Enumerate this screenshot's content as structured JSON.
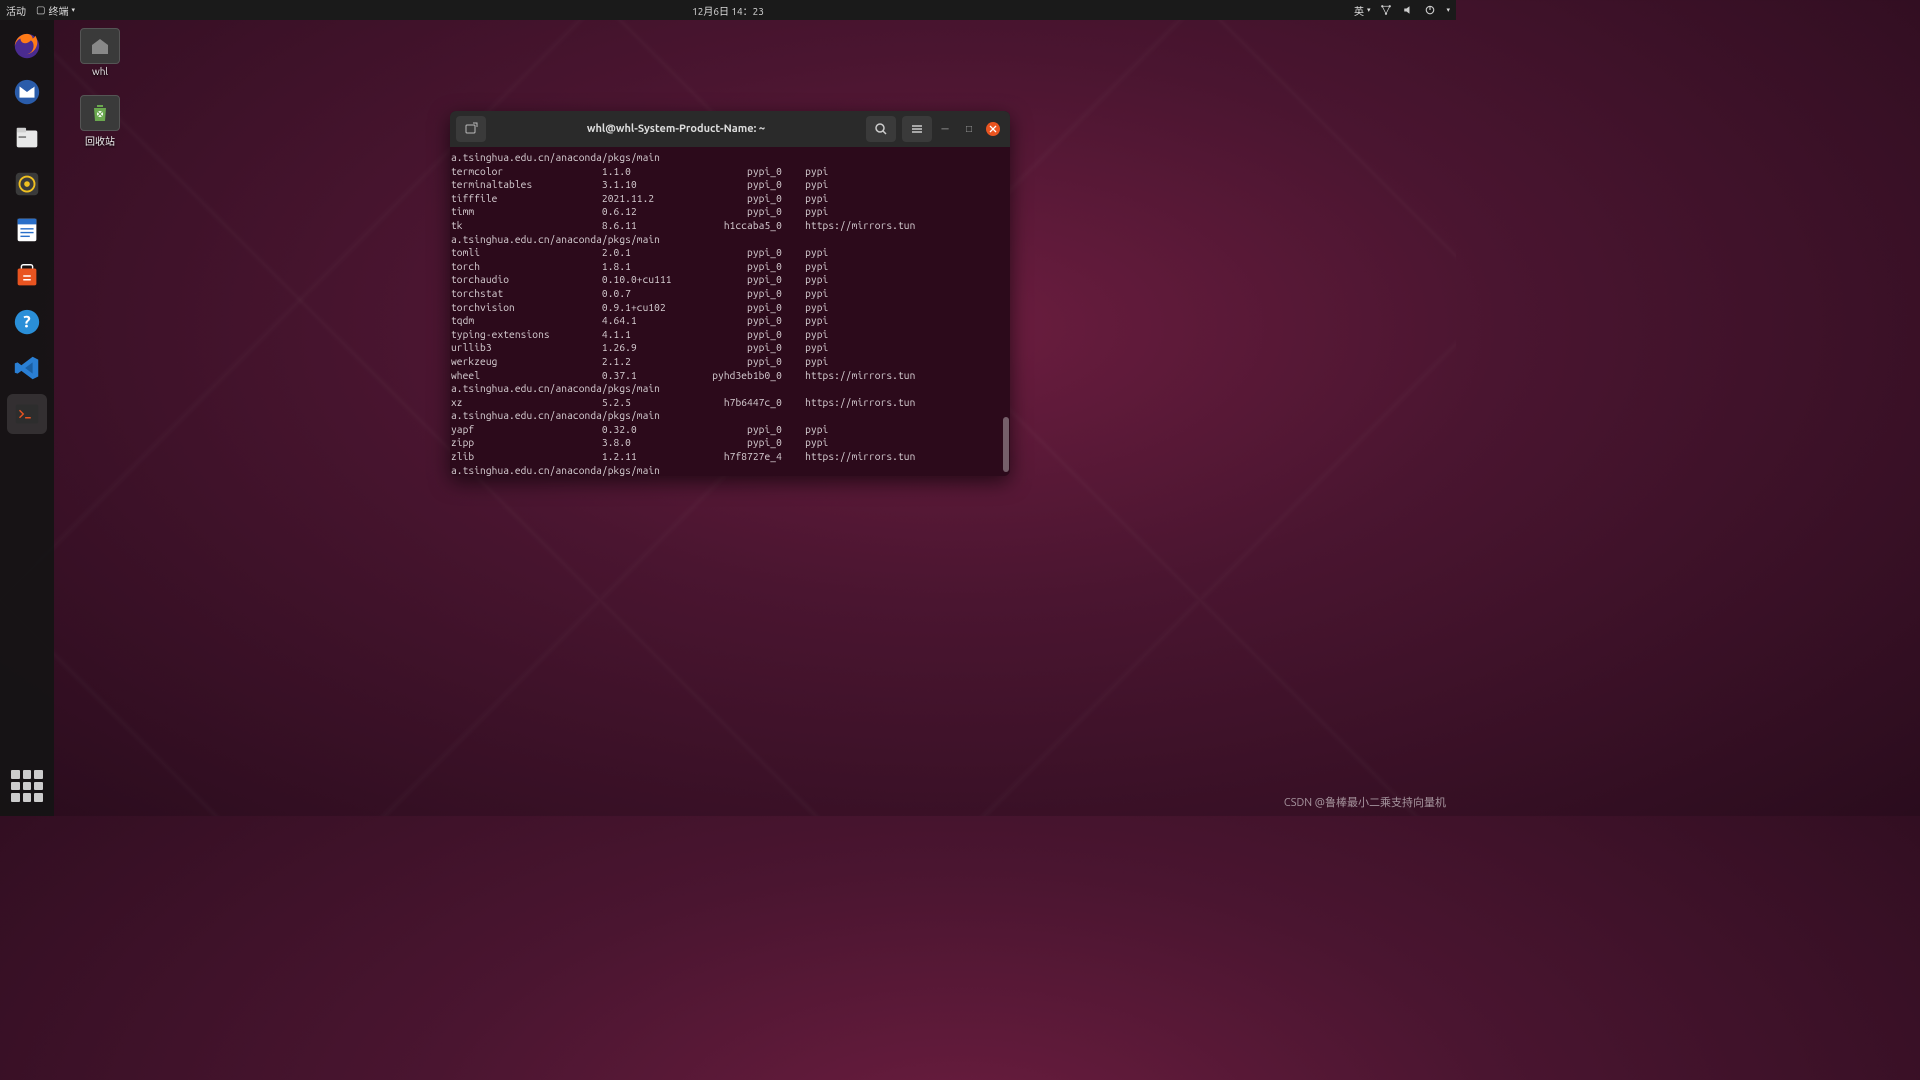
{
  "topbar": {
    "activities": "活动",
    "app_name": "终端",
    "datetime": "12月6日 14：23",
    "input_method": "英"
  },
  "desktop": {
    "folder_label": "whl",
    "trash_label": "回收站"
  },
  "terminal": {
    "title": "whl@whl-System-Product-Name: ~",
    "lines": [
      "a.tsinghua.edu.cn/anaconda/pkgs/main",
      "termcolor                 1.1.0                    pypi_0    pypi",
      "terminaltables            3.1.10                   pypi_0    pypi",
      "tifffile                  2021.11.2                pypi_0    pypi",
      "timm                      0.6.12                   pypi_0    pypi",
      "tk                        8.6.11               h1ccaba5_0    https://mirrors.tun",
      "a.tsinghua.edu.cn/anaconda/pkgs/main",
      "tomli                     2.0.1                    pypi_0    pypi",
      "torch                     1.8.1                    pypi_0    pypi",
      "torchaudio                0.10.0+cu111             pypi_0    pypi",
      "torchstat                 0.0.7                    pypi_0    pypi",
      "torchvision               0.9.1+cu102              pypi_0    pypi",
      "tqdm                      4.64.1                   pypi_0    pypi",
      "typing-extensions         4.1.1                    pypi_0    pypi",
      "urllib3                   1.26.9                   pypi_0    pypi",
      "werkzeug                  2.1.2                    pypi_0    pypi",
      "wheel                     0.37.1             pyhd3eb1b0_0    https://mirrors.tun",
      "a.tsinghua.edu.cn/anaconda/pkgs/main",
      "xz                        5.2.5                h7b6447c_0    https://mirrors.tun",
      "a.tsinghua.edu.cn/anaconda/pkgs/main",
      "yapf                      0.32.0                   pypi_0    pypi",
      "zipp                      3.8.0                    pypi_0    pypi",
      "zlib                      1.2.11               h7f8727e_4    https://mirrors.tun",
      "a.tsinghua.edu.cn/anaconda/pkgs/main"
    ]
  },
  "watermark": "CSDN @鲁棒最小二乘支持向量机"
}
